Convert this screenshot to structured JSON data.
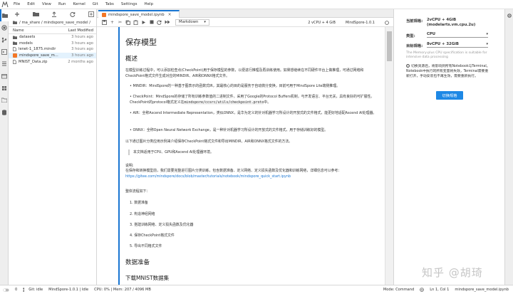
{
  "menubar": {
    "items": [
      "File",
      "Edit",
      "View",
      "Run",
      "Kernel",
      "Git",
      "Tabs",
      "Settings",
      "Help"
    ]
  },
  "file_browser": {
    "breadcrumb": "/ ma_share / mindspore_save_model /",
    "col_name": "Name",
    "col_modified": "Last Modified",
    "items": [
      {
        "name": "datasets",
        "modified": "3 hours ago",
        "icon": "folder-icon"
      },
      {
        "name": "models",
        "modified": "3 hours ago",
        "icon": "folder-icon"
      },
      {
        "name": "lenet-1_1875.mindir",
        "modified": "3 hours ago",
        "icon": "file-icon"
      },
      {
        "name": "mindspore_save_m...",
        "modified": "3 hours ago",
        "icon": "notebook-icon"
      },
      {
        "name": "MNIST_Data.zip",
        "modified": "2 months ago",
        "icon": "file-icon"
      }
    ]
  },
  "notebook": {
    "tab_title": "mindspore_save_model.ipynb",
    "cell_type": "Markdown",
    "resources": "2 vCPU + 4 GiB",
    "kernel": "MindSpore-1.0.1",
    "title": "保存模型",
    "overview_heading": "概述",
    "intro": "在模型训练过程中，可以添加检查点(CheckPoint)用于保存模型的参数，以便进行推理及再训练使用。如果想继续在不同硬件平台上做推理，可通过网络和CheckPoint格式文件生成对应的MINDIR、AIR和ONNX格式文件。",
    "bullets": [
      "MINDIR：MindSpore的一种基于图表示的函数式IR，其最核心的目的是服务于自动微分变换，目前可用于MindSpore Lite端侧推理。",
      "CheckPoint：MindSpore的存储了所有训练参数值的二进制文件。采用了Google的Protocol Buffers机制，与开发语言、平台无关，具有良好的可扩展性。CheckPoint的protocol格式定义在",
      "AIR：全称Ascend Intermediate Representation，类似ONNX，是华为定义的针对机器学习所设计的开放式的文件格式，能更好地适配Ascend AI处理器。",
      "ONNX：全称Open Neural Network Exchange，是一种针对机器学习所设计的开放式的文件格式，用于存储训练好的模型。"
    ],
    "checkpoint_code": "mindspore/ccsrc/utils/checkpoint.proto",
    "checkpoint_tail": "中。",
    "example_intro": "以下通过图片分类应用示例来介绍保存CheckPoint格式文件和导出MINDIR、AIR和ONNX格式文件的方法。",
    "quote": "本文档适用于CPU、GPU和Ascend AI处理器环境。",
    "note_label": "说明:",
    "note_text": "在保存和转换模型前，我们需要完整进行图片分类训练，包含数据准备、定义网络、定义损失函数及优化器和训练网络，详细信息可以参考：",
    "note_link": "https://gitee.com/mindspore/docs/blob/master/tutorials/notebook/mindspore_quick_start.ipynb",
    "flow_label": "整体流程如下：",
    "steps": [
      "1. 数据准备",
      "2. 构造神经网络",
      "3. 搭建训练网络、定义损失函数及优化器",
      "4. 保存CheckPoint格式文件",
      "5. 导出不同格式文件"
    ],
    "section_data": "数据准备",
    "section_download": "下载MNIST数据集"
  },
  "resource_panel": {
    "current_label": "当前规格:",
    "current_value": "2vCPU + 4GiB (modelarts.vm.cpu.2u)",
    "type_label": "类型:",
    "type_value": "CPU",
    "target_label": "目标规格:",
    "target_value": "8vCPU + 32GiB",
    "hint": "The Memory-plus CPU specification is suitable for intensive data processing",
    "note": "切换资源后，将影响到所有Notebook与Terminal。Notebook中执行的所有变量将失效，Terminal需要重新打开，手动安装包不再生效，需要重新执行。",
    "button": "切换规格"
  },
  "statusbar": {
    "git": "Git: idle",
    "kernel": "MindSpore-1.0.1 | Idle",
    "cpu_mem": "CPU: 0% | Mem: 207 / 4096 MB",
    "mode": "Mode: Command",
    "position": "Ln 1, Col 1",
    "file": "mindspore_save_model.ipynb"
  },
  "watermark": "知乎 @胡琦"
}
